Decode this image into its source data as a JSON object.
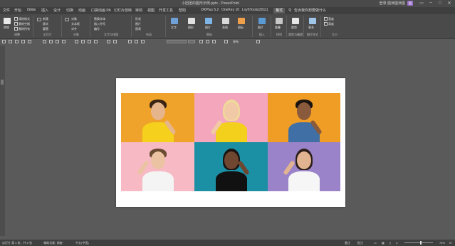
{
  "window": {
    "title": "小团团的图形示例.pptx - PowerPoint",
    "user": "登录",
    "user_name": "图演图演图",
    "avatar": "图"
  },
  "menu": {
    "items": [
      "文件",
      "开始",
      "iSlide",
      "插入",
      "设计",
      "切换",
      "动画",
      "口袋动画 PA",
      "幻灯片放映",
      "审阅",
      "视图",
      "开发工具",
      "帮助",
      "OKPlus 5.2",
      "OneKey 10",
      "LvyhTools(2011)",
      "格式",
      "告诉我你想要做什么"
    ],
    "active": "格式"
  },
  "ribbon": {
    "groups": [
      "调整",
      "幻灯片",
      "对象",
      "文字与排版",
      "布局",
      "图标",
      "插入",
      "排列",
      "裁剪与编辑",
      "图片样式",
      "大小"
    ],
    "items": {
      "g1": [
        "转换",
        "清除格式",
        "删除空格",
        "删除所有"
      ],
      "g2": [
        "新建",
        "版式",
        "重置"
      ],
      "g3": [
        "对象",
        "文本框",
        "对齐"
      ],
      "g4": [
        "替换字体",
        "插入符号",
        "编号"
      ],
      "g5": [
        "形状",
        "图片",
        "图表"
      ],
      "g6": [
        "文字",
        "图形",
        "图片",
        "表格",
        "图标"
      ],
      "g7": [
        "图片",
        "视频",
        "声音"
      ],
      "g8": [
        "重叠"
      ],
      "g9": [
        "裁剪",
        "蒙版"
      ],
      "g10": [
        "更多"
      ],
      "g11": [
        "宽度",
        "高度"
      ]
    }
  },
  "toolbar": {
    "layout_label": "排布",
    "font_size": "14"
  },
  "slide": {
    "tiles": [
      {
        "bg": "#f0a32a",
        "shirt": "#f5d01c",
        "hair": "#3a2414",
        "skin": "#e6b58c"
      },
      {
        "bg": "#f4a6bd",
        "shirt": "#f3d01b",
        "hair": "#f0d99a",
        "skin": "#f1c9a7"
      },
      {
        "bg": "#ef9d25",
        "shirt": "#3f6fa4",
        "hair": "#1b1410",
        "skin": "#8a5a3c"
      },
      {
        "bg": "#f7b9c4",
        "shirt": "#f4f4f4",
        "hair": "#6a4a30",
        "skin": "#ebc3a2"
      },
      {
        "bg": "#1b8fa3",
        "shirt": "#111111",
        "hair": "#1a1412",
        "skin": "#6f4630"
      },
      {
        "bg": "#9a83c9",
        "shirt": "#f6f6f6",
        "hair": "#2c1f19",
        "skin": "#e2b391"
      }
    ]
  },
  "status": {
    "slide_info": "幻灯片 第 4 张，共 6 张",
    "accessibility": "\"辅助功能: 调查\"",
    "language": "中文(中国)",
    "notes": "备注",
    "comments": "批注",
    "zoom": "75%"
  }
}
